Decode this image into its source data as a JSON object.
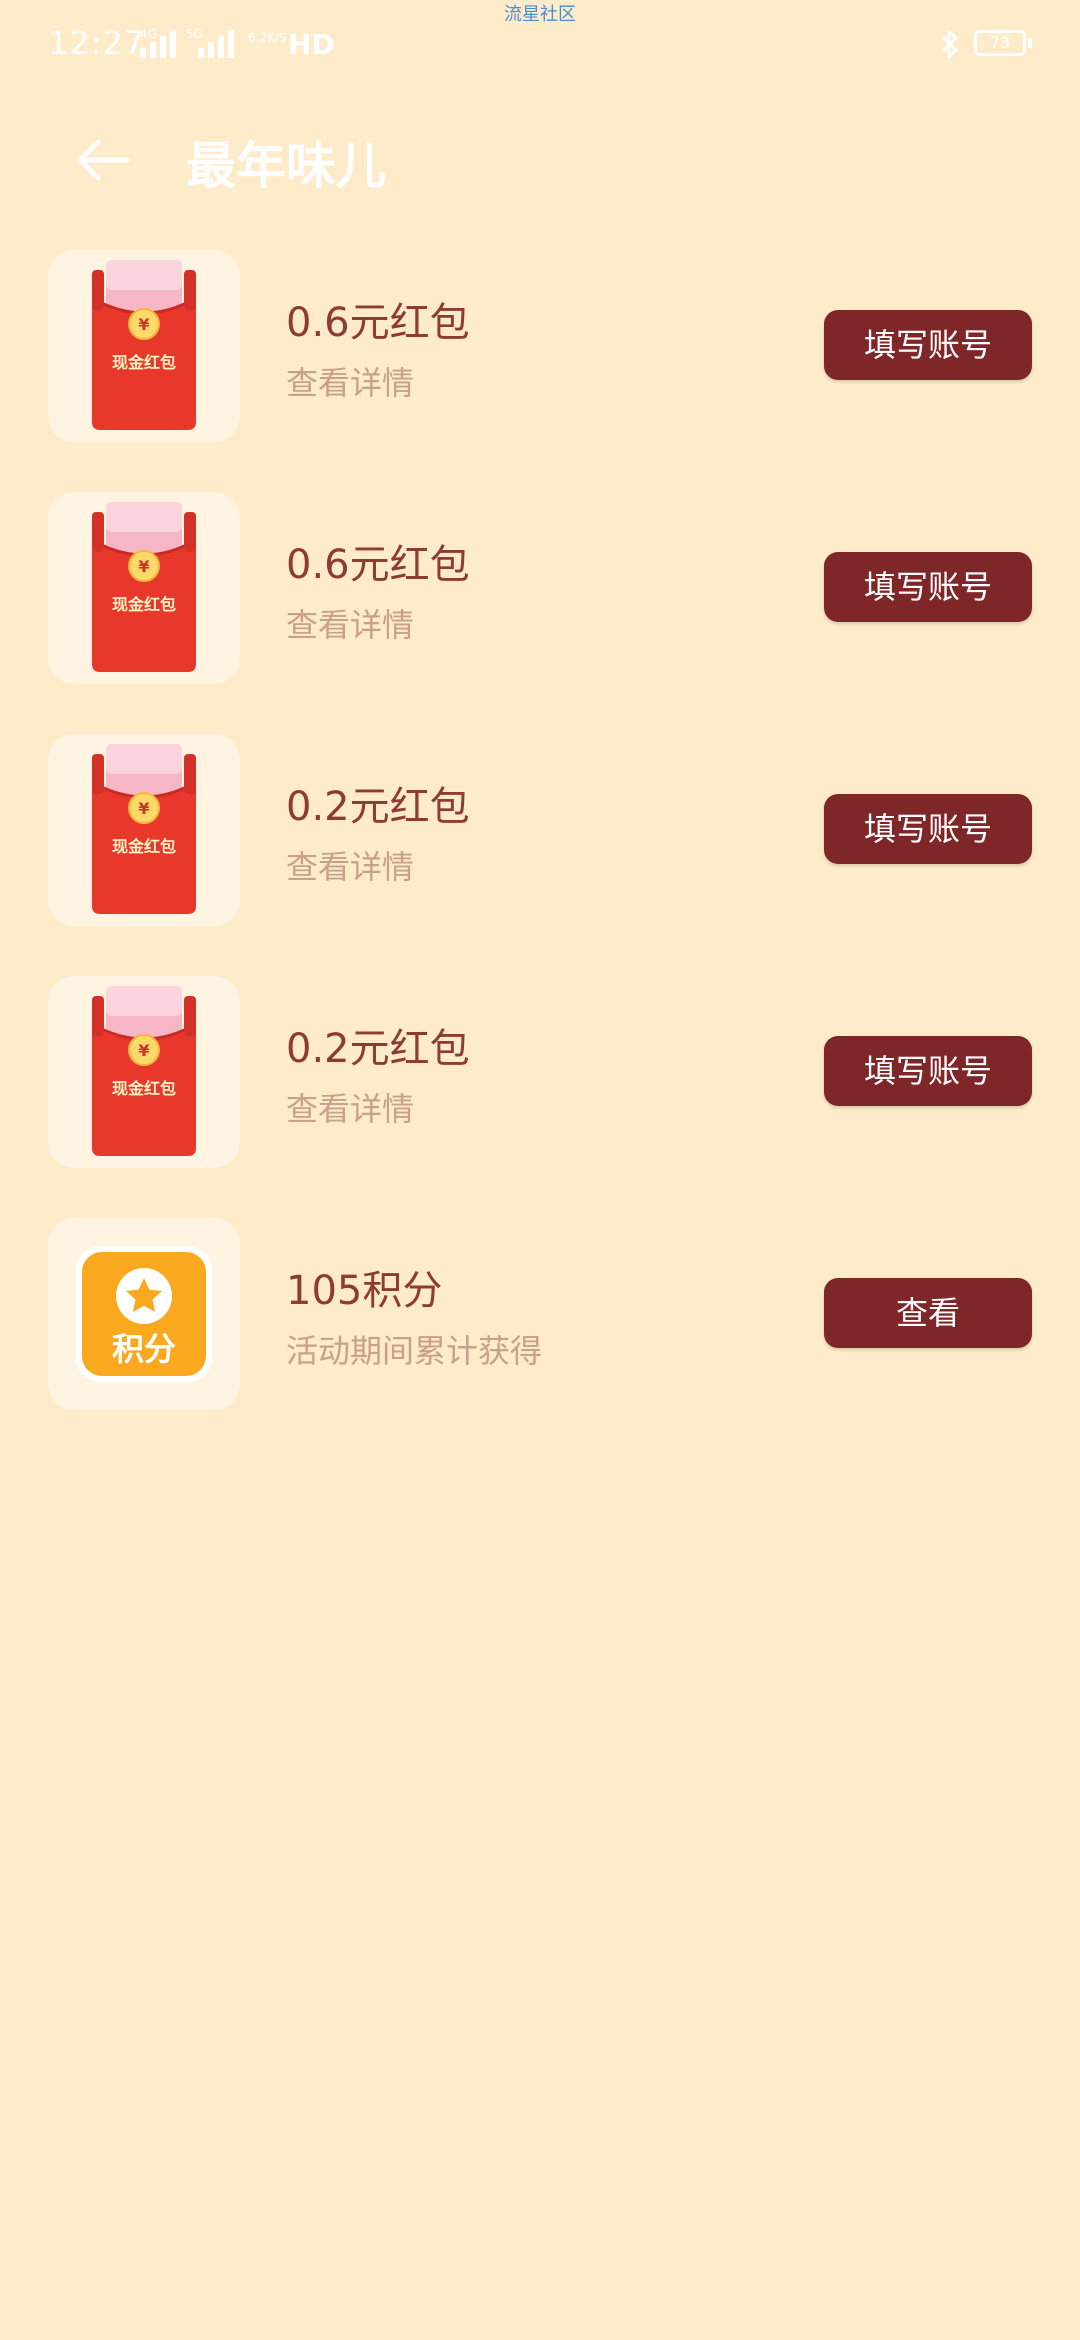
{
  "status_bar": {
    "time": "12:27",
    "watermark": "流星社区",
    "network_hd": "HD",
    "network_mini": [
      "4G",
      "5G",
      "6.2K/S"
    ],
    "battery": "73"
  },
  "header": {
    "title": "最年味儿"
  },
  "items": [
    {
      "title": "0.6元红包",
      "subtitle": "查看详情",
      "button": "填写账号",
      "icon_text": "现金红包",
      "icon_symbol": "¥"
    },
    {
      "title": "0.6元红包",
      "subtitle": "查看详情",
      "button": "填写账号",
      "icon_text": "现金红包",
      "icon_symbol": "¥"
    },
    {
      "title": "0.2元红包",
      "subtitle": "查看详情",
      "button": "填写账号",
      "icon_text": "现金红包",
      "icon_symbol": "¥"
    },
    {
      "title": "0.2元红包",
      "subtitle": "查看详情",
      "button": "填写账号",
      "icon_text": "现金红包",
      "icon_symbol": "¥"
    }
  ],
  "points_item": {
    "title": "105积分",
    "subtitle": "活动期间累计获得",
    "button": "查看",
    "icon_text": "积分"
  },
  "colors": {
    "background": "#FDEBCA",
    "button": "#7F2629",
    "title_text": "#8E3B32",
    "subtitle_text": "#C9A08A",
    "envelope_red": "#E8382C",
    "points_orange": "#FAA81E"
  }
}
